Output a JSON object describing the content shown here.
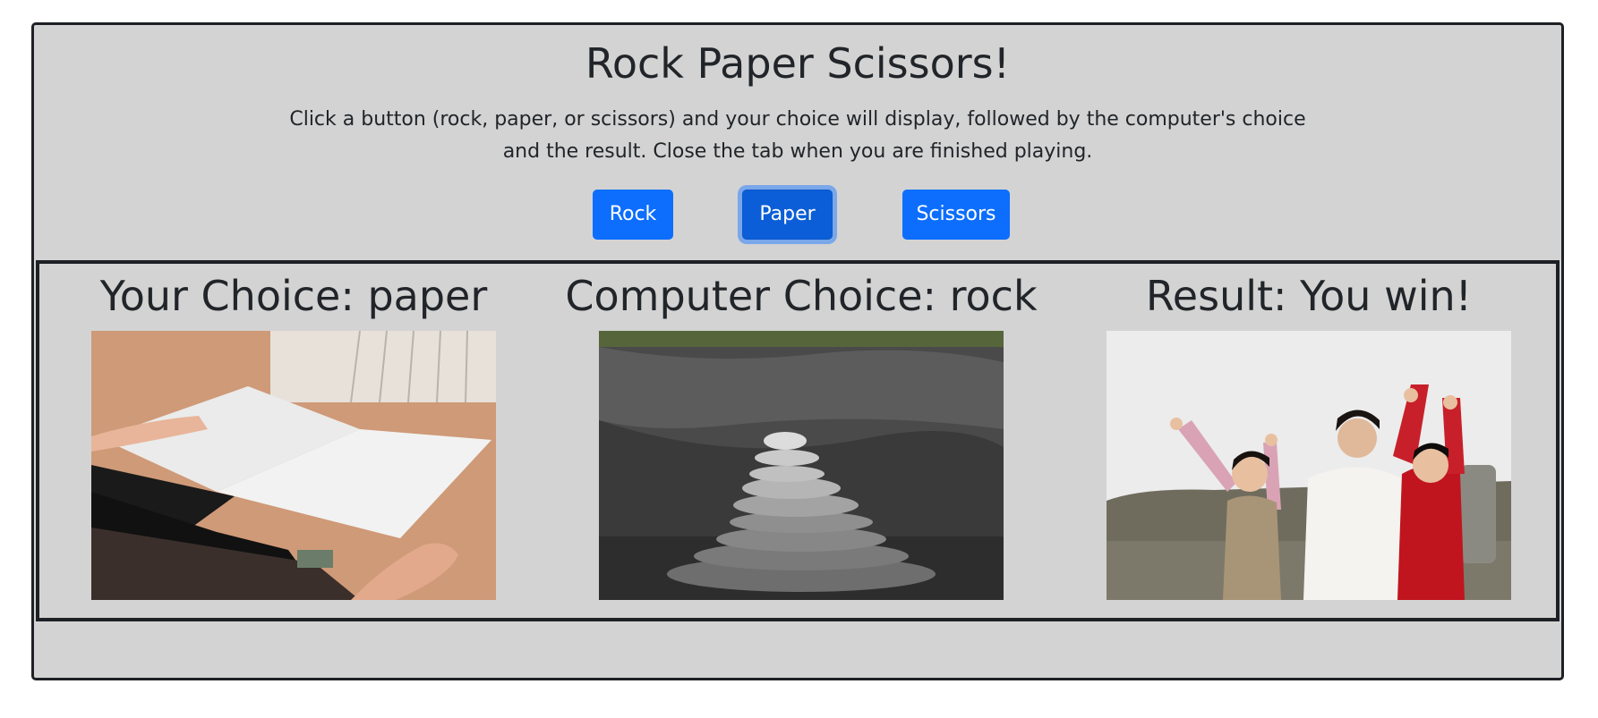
{
  "header": {
    "title": "Rock Paper Scissors!",
    "description": "Click a button (rock, paper, or scissors) and your choice will display, followed by the computer's choice and the result. Close the tab when you are finished playing."
  },
  "buttons": {
    "rock_label": "Rock",
    "paper_label": "Paper",
    "scissors_label": "Scissors",
    "active": "Paper"
  },
  "results": {
    "your_choice": "Your Choice: paper",
    "computer_choice": "Computer Choice: rock",
    "result": "Result: You win!"
  },
  "images": {
    "your_choice": "photo of hands holding open a sheet of paper",
    "computer_choice": "photo of stacked stones",
    "result": "photo of woman and two children cheering"
  },
  "colors": {
    "panel_background": "#d3d3d3",
    "button_primary": "#0d6efd",
    "border": "#1d2024"
  }
}
